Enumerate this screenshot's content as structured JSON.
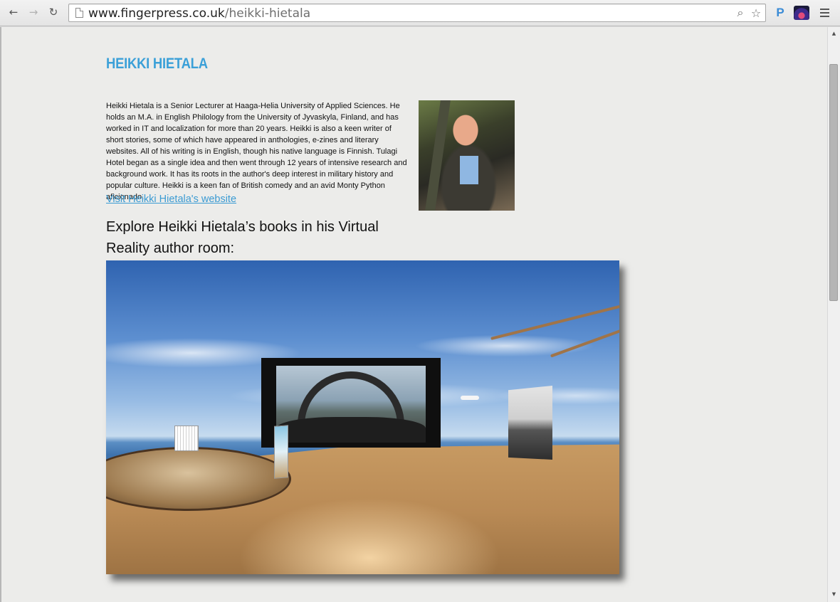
{
  "browser": {
    "url_host": "www.fingerpress.co.uk",
    "url_path": "/heikki-hietala",
    "extension_p_label": "P"
  },
  "page": {
    "title": "HEIKKI HIETALA",
    "bio": "Heikki Hietala is a Senior Lecturer at Haaga-Helia University of Applied Sciences. He holds an M.A. in English Philology from the University of Jyvaskyla, Finland, and has worked in IT and localization for more than 20 years. Heikki is also a keen writer of short stories, some of which have appeared in anthologies, e-zines and literary websites. All of his writing is in English, though his native language is Finnish. Tulagi Hotel began as a single idea and then went through 12 years of intensive research and background work. It has its roots in the author's deep interest in military history and popular culture. Heikki is a keen fan of British comedy and an avid Monty Python aficionado.",
    "website_link": "Visit Heikki Hietala's website",
    "vr_heading": "Explore Heikki Hietala’s books in his Virtual Reality author room:"
  },
  "colors": {
    "title": "#3ba0d8",
    "link": "#3b9bd3",
    "background": "#ececea"
  },
  "icons": {
    "back": "back-arrow-icon",
    "forward": "forward-arrow-icon",
    "reload": "reload-icon",
    "page": "page-icon",
    "search": "search-icon",
    "bookmark": "star-icon",
    "menu": "hamburger-menu-icon"
  }
}
